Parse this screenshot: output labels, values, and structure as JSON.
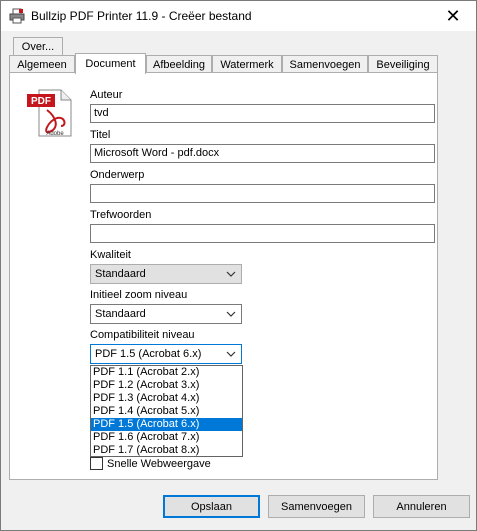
{
  "window": {
    "title": "Bullzip PDF Printer 11.9 - Creëer bestand",
    "close_glyph": "✕"
  },
  "tabs": {
    "row_back": [
      {
        "label": "Over..."
      }
    ],
    "row_front": [
      {
        "label": "Algemeen",
        "active": false
      },
      {
        "label": "Document",
        "active": true
      },
      {
        "label": "Afbeelding",
        "active": false
      },
      {
        "label": "Watermerk",
        "active": false
      },
      {
        "label": "Samenvoegen",
        "active": false
      },
      {
        "label": "Beveiliging",
        "active": false
      }
    ]
  },
  "icons": {
    "app": "printer-icon",
    "pdf": "pdf-file-icon",
    "pdf_badge": "PDF",
    "pdf_brand": "Adobe"
  },
  "document": {
    "author_label": "Auteur",
    "author_value": "tvd",
    "title_label": "Titel",
    "title_value": "Microsoft Word - pdf.docx",
    "subject_label": "Onderwerp",
    "subject_value": "",
    "keywords_label": "Trefwoorden",
    "keywords_value": "",
    "quality_label": "Kwaliteit",
    "quality_value": "Standaard",
    "zoom_label": "Initieel zoom niveau",
    "zoom_value": "Standaard",
    "compat_label": "Compatibiliteit niveau",
    "compat_value": "PDF 1.5 (Acrobat 6.x)",
    "compat_options": [
      {
        "label": "PDF 1.1 (Acrobat 2.x)",
        "selected": false
      },
      {
        "label": "PDF 1.2 (Acrobat 3.x)",
        "selected": false
      },
      {
        "label": "PDF 1.3 (Acrobat 4.x)",
        "selected": false
      },
      {
        "label": "PDF 1.4 (Acrobat 5.x)",
        "selected": false
      },
      {
        "label": "PDF 1.5 (Acrobat 6.x)",
        "selected": true
      },
      {
        "label": "PDF 1.6 (Acrobat 7.x)",
        "selected": false
      },
      {
        "label": "PDF 1.7 (Acrobat 8.x)",
        "selected": false
      }
    ],
    "fast_web_label": "Snelle Webweergave",
    "fast_web_checked": false
  },
  "buttons": {
    "save": "Opslaan",
    "merge": "Samenvoegen",
    "cancel": "Annuleren"
  },
  "colors": {
    "accent": "#0078d7",
    "pdf_red": "#c4161c"
  }
}
